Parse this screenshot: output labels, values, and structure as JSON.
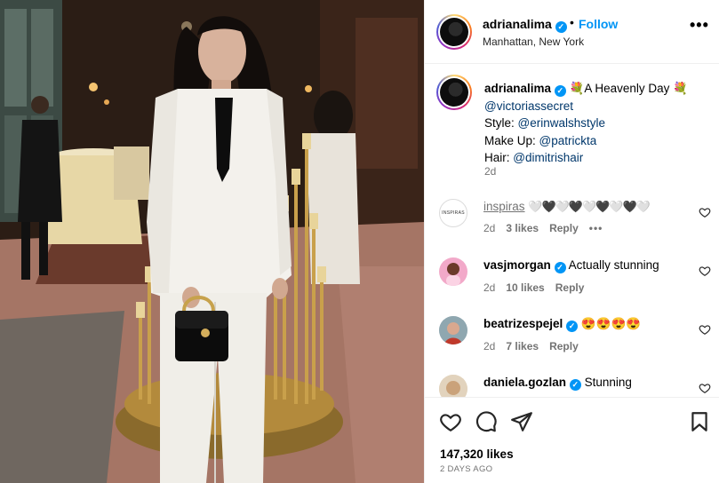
{
  "post": {
    "username": "adrianalima",
    "follow_label": "Follow",
    "separator": "•",
    "location": "Manhattan, New York",
    "more_label": "•••"
  },
  "caption": {
    "username": "adrianalima",
    "text_start": "💐A Heavenly Day 💐",
    "mention_main": "@victoriassecret",
    "style_label": "Style: ",
    "style_handle": "@erinwalshstyle",
    "makeup_label": "Make Up: ",
    "makeup_handle": "@patrickta",
    "hair_label": "Hair: ",
    "hair_handle": "@dimitrishair",
    "time": "2d"
  },
  "comments": [
    {
      "username": "inspiras",
      "text": "🤍🖤🤍🖤🤍🖤🤍🖤🤍",
      "time": "2d",
      "likes": "3 likes",
      "reply": "Reply",
      "more": "•••",
      "avatar_text": "INSPIRAS"
    },
    {
      "username": "vasjmorgan",
      "text": "Actually stunning",
      "time": "2d",
      "likes": "10 likes",
      "reply": "Reply"
    },
    {
      "username": "beatrizespejel",
      "text": "😍😍😍😍",
      "time": "2d",
      "likes": "7 likes",
      "reply": "Reply"
    },
    {
      "username": "daniela.gozlan",
      "text": "Stunning"
    }
  ],
  "footer": {
    "likes": "147,320 likes",
    "ago": "2 DAYS AGO"
  },
  "colors": {
    "accent": "#0095f6",
    "link": "#00376b",
    "muted": "#737373",
    "border": "#efefef"
  },
  "icons": [
    "heart-icon",
    "comment-icon",
    "share-icon",
    "bookmark-icon",
    "verified-icon",
    "more-icon"
  ]
}
